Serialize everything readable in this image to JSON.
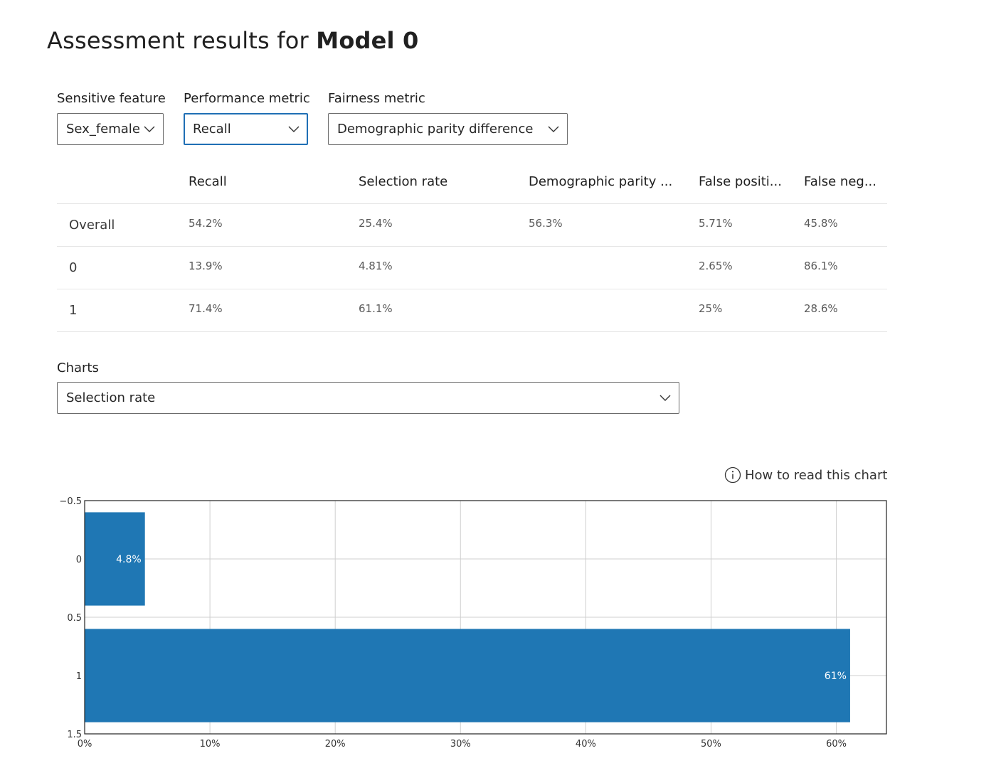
{
  "header": {
    "title_prefix": "Assessment results for ",
    "title_model": "Model 0"
  },
  "controls": {
    "sensitive_feature": {
      "label": "Sensitive feature",
      "value": "Sex_female"
    },
    "performance_metric": {
      "label": "Performance metric",
      "value": "Recall"
    },
    "fairness_metric": {
      "label": "Fairness metric",
      "value": "Demographic parity difference"
    }
  },
  "table": {
    "columns": [
      "Recall",
      "Selection rate",
      "Demographic parity ...",
      "False positi...",
      "False neg..."
    ],
    "rows": [
      {
        "label": "Overall",
        "cells": [
          "54.2%",
          "25.4%",
          "56.3%",
          "5.71%",
          "45.8%"
        ]
      },
      {
        "label": "0",
        "cells": [
          "13.9%",
          "4.81%",
          "",
          "2.65%",
          "86.1%"
        ]
      },
      {
        "label": "1",
        "cells": [
          "71.4%",
          "61.1%",
          "",
          "25%",
          "28.6%"
        ]
      }
    ]
  },
  "charts": {
    "label": "Charts",
    "selected": "Selection rate",
    "how_to_read": "How to read this chart"
  },
  "colors": {
    "bar": "#1f77b4",
    "focus_border": "#1f6fb5"
  },
  "chart_data": {
    "type": "bar",
    "orientation": "horizontal",
    "categories": [
      "0",
      "1"
    ],
    "values": [
      4.81,
      61.1
    ],
    "data_labels": [
      "4.8%",
      "61%"
    ],
    "xlim": [
      0,
      64
    ],
    "x_ticks": [
      "0%",
      "10%",
      "20%",
      "30%",
      "40%",
      "50%",
      "60%"
    ],
    "x_tick_values": [
      0,
      10,
      20,
      30,
      40,
      50,
      60
    ],
    "ylim": [
      -0.5,
      1.5
    ],
    "y_ticks": [
      "−0.5",
      "0",
      "0.5",
      "1",
      "1.5"
    ],
    "y_tick_values": [
      -0.5,
      0,
      0.5,
      1,
      1.5
    ],
    "grid": true,
    "title": "",
    "xlabel": "",
    "ylabel": ""
  }
}
